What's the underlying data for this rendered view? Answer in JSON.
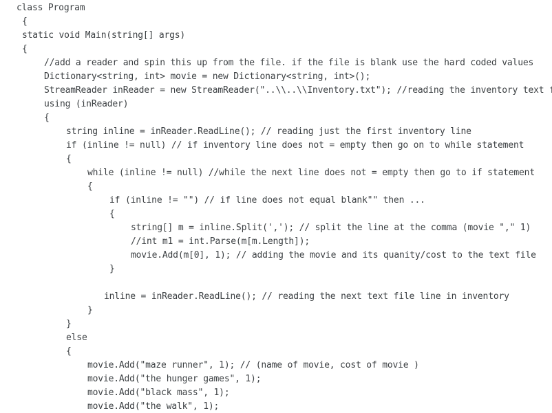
{
  "code": {
    "language": "csharp",
    "lines": [
      {
        "indent": 24,
        "text": "class Program"
      },
      {
        "indent": 32,
        "text": "{"
      },
      {
        "indent": 32,
        "text": "static void Main(string[] args)"
      },
      {
        "indent": 32,
        "text": "{"
      },
      {
        "indent": 64,
        "text": "//add a reader and spin this up from the file. if the file is blank use the hard coded values"
      },
      {
        "indent": 64,
        "text": "Dictionary<string, int> movie = new Dictionary<string, int>();"
      },
      {
        "indent": 64,
        "text": "StreamReader inReader = new StreamReader(\"..\\\\..\\\\Inventory.txt\"); //reading the inventory text file"
      },
      {
        "indent": 64,
        "text": "using (inReader)"
      },
      {
        "indent": 64,
        "text": "{"
      },
      {
        "indent": 96,
        "text": "string inline = inReader.ReadLine(); // reading just the first inventory line"
      },
      {
        "indent": 96,
        "text": "if (inline != null) // if inventory line does not = empty then go on to while statement"
      },
      {
        "indent": 96,
        "text": "{"
      },
      {
        "indent": 127,
        "text": "while (inline != null) //while the next line does not = empty then go to if statement"
      },
      {
        "indent": 127,
        "text": "{"
      },
      {
        "indent": 159,
        "text": "if (inline != \"\") // if line does not equal blank\"\" then ..."
      },
      {
        "indent": 159,
        "text": "{"
      },
      {
        "indent": 190,
        "text": "string[] m = inline.Split(','); // split the line at the comma (movie \",\" 1)"
      },
      {
        "indent": 190,
        "text": "//int m1 = int.Parse(m[m.Length]);"
      },
      {
        "indent": 190,
        "text": "movie.Add(m[0], 1); // adding the movie and its quanity/cost to the text file"
      },
      {
        "indent": 159,
        "text": "}"
      },
      {
        "indent": 0,
        "text": ""
      },
      {
        "indent": 151,
        "text": "inline = inReader.ReadLine(); // reading the next text file line in inventory"
      },
      {
        "indent": 127,
        "text": "}"
      },
      {
        "indent": 96,
        "text": "}"
      },
      {
        "indent": 96,
        "text": "else"
      },
      {
        "indent": 96,
        "text": "{"
      },
      {
        "indent": 127,
        "text": "movie.Add(\"maze runner\", 1); // (name of movie, cost of movie )"
      },
      {
        "indent": 127,
        "text": "movie.Add(\"the hunger games\", 1);"
      },
      {
        "indent": 127,
        "text": "movie.Add(\"black mass\", 1);"
      },
      {
        "indent": 127,
        "text": "movie.Add(\"the walk\", 1);"
      }
    ]
  }
}
